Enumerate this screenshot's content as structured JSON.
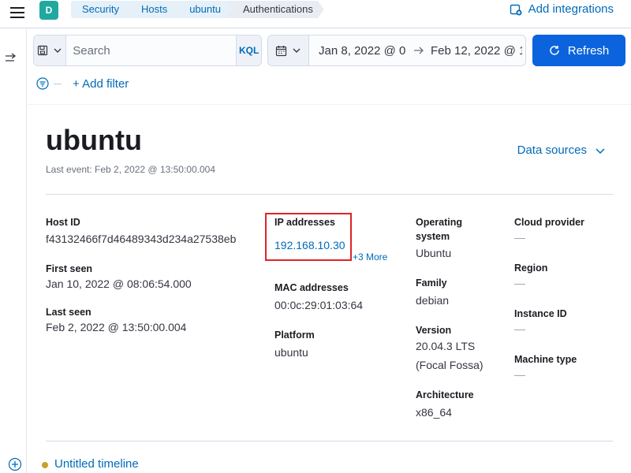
{
  "header": {
    "avatar_letter": "D",
    "breadcrumbs": [
      "Security",
      "Hosts",
      "ubuntu",
      "Authentications"
    ],
    "add_integrations": "Add integrations"
  },
  "querybar": {
    "search_placeholder": "Search",
    "kql_label": "KQL"
  },
  "datebar": {
    "start": "Jan 8, 2022 @ 0",
    "end": "Feb 12, 2022 @ 1"
  },
  "refresh_label": "Refresh",
  "add_filter_label": "+ Add filter",
  "host": {
    "name": "ubuntu",
    "last_event": "Last event: Feb 2, 2022 @ 13:50:00.004",
    "data_sources_label": "Data sources",
    "fields": {
      "host_id_title": "Host ID",
      "host_id": "f43132466f7d46489343d234a27538eb",
      "first_seen_title": "First seen",
      "first_seen": "Jan 10, 2022 @ 08:06:54.000",
      "last_seen_title": "Last seen",
      "last_seen": "Feb 2, 2022 @ 13:50:00.004",
      "ip_title": "IP addresses",
      "ip_value": "192.168.10.30",
      "ip_more": "+3 More",
      "mac_title": "MAC addresses",
      "mac_value": "00:0c:29:01:03:64",
      "platform_title": "Platform",
      "platform_value": "ubuntu",
      "os_title_1": "Operating",
      "os_title_2": "system",
      "os_value": "Ubuntu",
      "family_title": "Family",
      "family_value": "debian",
      "version_title": "Version",
      "version_line1": "20.04.3 LTS",
      "version_line2": "(Focal Fossa)",
      "arch_title": "Architecture",
      "arch_value": "x86_64",
      "cloud_title": "Cloud provider",
      "cloud_value": "—",
      "region_title": "Region",
      "region_value": "—",
      "instance_title": "Instance ID",
      "instance_value": "—",
      "machine_title": "Machine type",
      "machine_value": "—"
    }
  },
  "timeline": {
    "name": "Untitled timeline"
  },
  "colors": {
    "accent": "#006bb8",
    "refresh_button": "#0b64dd",
    "highlight_box": "#e02424",
    "avatar": "#20a8a0",
    "timeline_dot": "#c9a227"
  },
  "icons": [
    "menu-icon",
    "add-integrations-icon",
    "save-query-icon",
    "chevron-down-icon",
    "calendar-icon",
    "arrow-right-icon",
    "refresh-icon",
    "filter-icon",
    "collapse-sidebar-icon",
    "add-timeline-icon"
  ]
}
